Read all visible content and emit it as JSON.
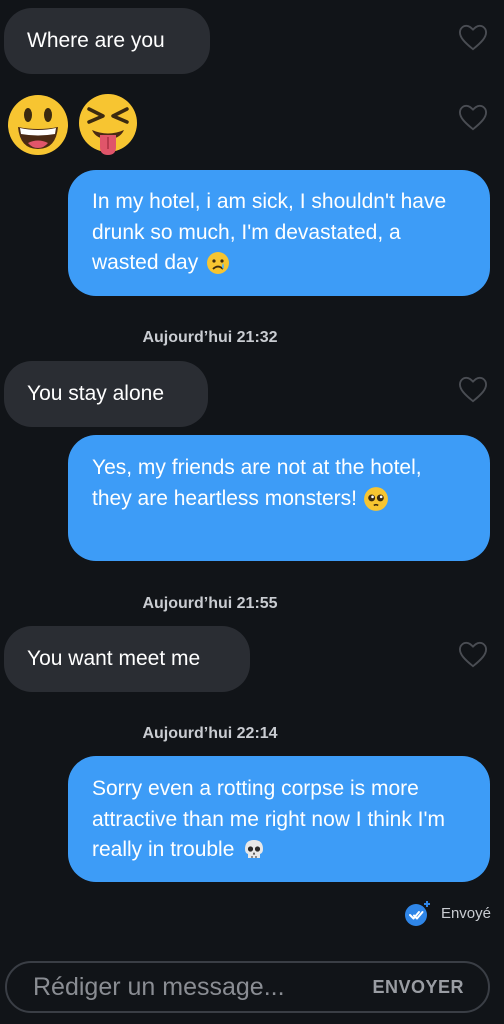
{
  "messages": [
    {
      "text": "Where are you"
    },
    {
      "emojis": [
        "grinning-face-emoji",
        "squinting-tongue-face-emoji"
      ]
    },
    {
      "text": "In my hotel, i am sick, I shouldn't have drunk so much, I'm devastated, a wasted day",
      "emoji": "crying-face-emoji"
    },
    {
      "text": "You stay alone"
    },
    {
      "text": "Yes, my friends are not at the hotel, they are heartless monsters!",
      "emoji": "pleading-face-emoji"
    },
    {
      "text": "You want meet me"
    },
    {
      "text": "Sorry even a rotting corpse is more attractive than me right now I think I'm really in trouble",
      "emoji": "skull-emoji"
    }
  ],
  "timestamps": [
    "Aujourd’hui 21:32",
    "Aujourd’hui 21:55",
    "Aujourd’hui 22:14"
  ],
  "status": {
    "label": "Envoyé"
  },
  "composer": {
    "placeholder": "Rédiger un message...",
    "send_label": "ENVOYER"
  },
  "colors": {
    "outgoing": "#3d9cf7",
    "incoming": "#2a2d33",
    "background": "#111418"
  }
}
